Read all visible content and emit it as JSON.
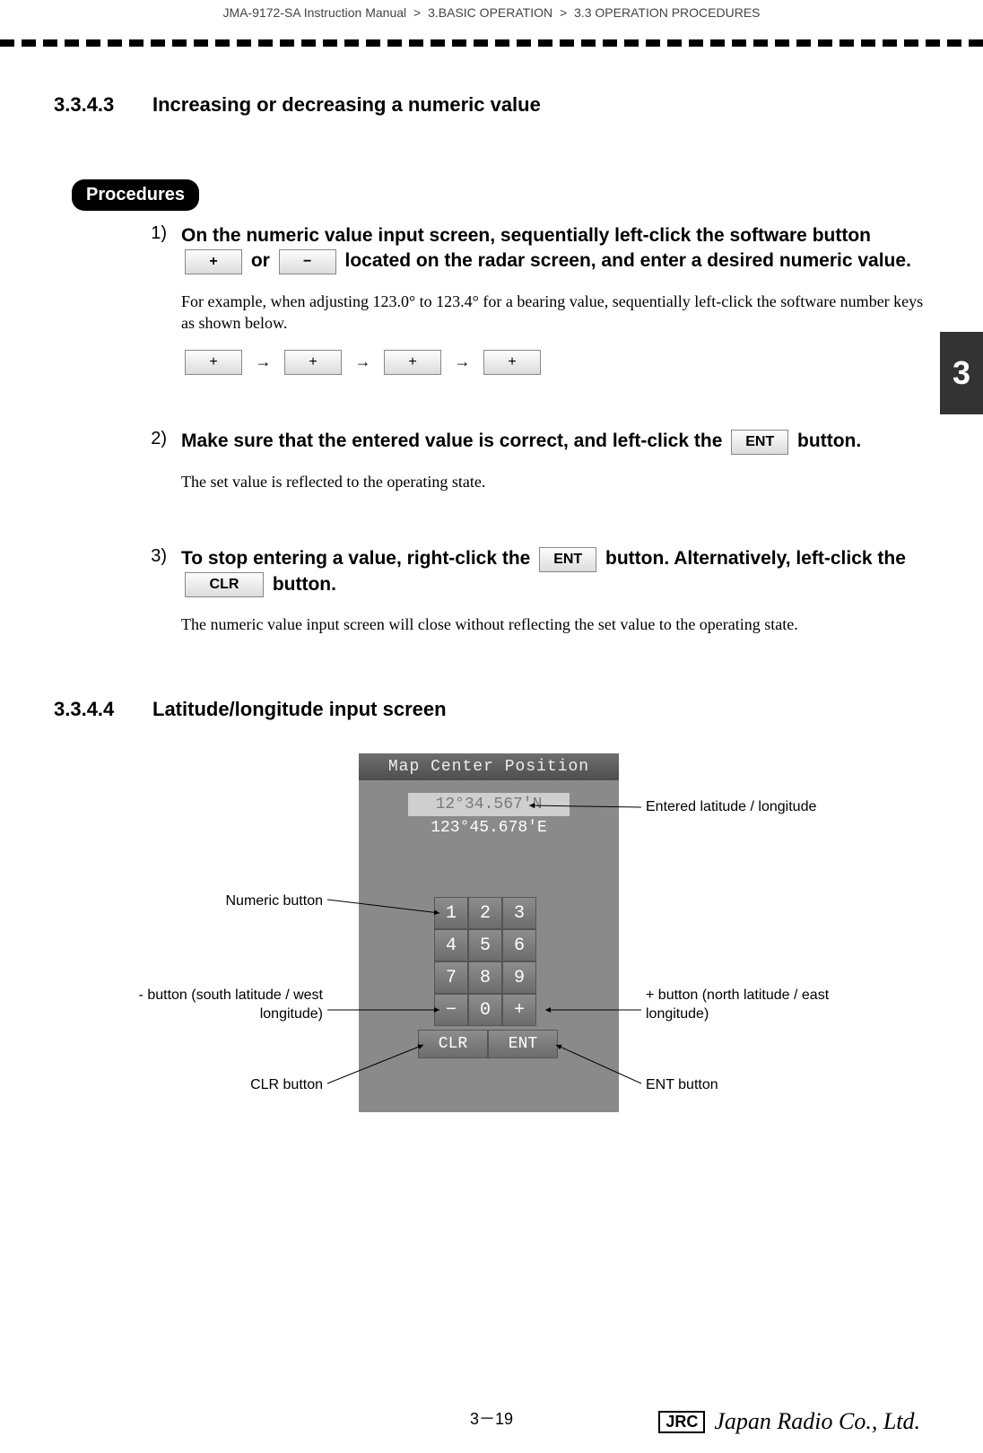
{
  "breadcrumb": {
    "a": "JMA-9172-SA Instruction Manual",
    "b": "3.BASIC OPERATION",
    "c": "3.3  OPERATION PROCEDURES",
    "sep": ">"
  },
  "chapter_tab": "3",
  "section_3343": {
    "num": "3.3.4.3",
    "title": "Increasing or decreasing a numeric value"
  },
  "procedures_label": "Procedures",
  "step1": {
    "num": "1)",
    "lead_a": "On the numeric value input screen, sequentially left-click the software button ",
    "btn_plus": "+",
    "lead_or": " or ",
    "btn_minus": "−",
    "lead_b": " located on the radar screen, and enter a desired numeric value.",
    "para": "For example, when adjusting 123.0° to 123.4° for a bearing value, sequentially left-click the software number keys as shown below.",
    "seq_btn": "+",
    "arrow": "→"
  },
  "step2": {
    "num": "2)",
    "lead_a": "Make sure that the entered value is correct, and left-click the ",
    "btn_ent": "ENT",
    "lead_b": " button.",
    "para": "The set value is reflected to the operating state."
  },
  "step3": {
    "num": "3)",
    "lead_a": "To stop entering a value, right-click the ",
    "btn_ent": "ENT",
    "lead_b": " button. Alternatively, left-click the ",
    "btn_clr": "CLR",
    "lead_c": " button.",
    "para": "The numeric value input screen will close without reflecting the set value to the operating state."
  },
  "section_3344": {
    "num": "3.3.4.4",
    "title": "Latitude/longitude input screen"
  },
  "lat_panel": {
    "title": "Map Center Position",
    "lat": "12°34.567'N",
    "lon": "123°45.678'E",
    "keys": [
      "1",
      "2",
      "3",
      "4",
      "5",
      "6",
      "7",
      "8",
      "9",
      "−",
      "0",
      "+"
    ],
    "clr": "CLR",
    "ent": "ENT"
  },
  "callouts": {
    "numeric": "Numeric button",
    "minus": "- button (south latitude / west longitude)",
    "clr": "CLR button",
    "entered": "Entered latitude / longitude",
    "plus": "+ button (north latitude / east longitude)",
    "ent": "ENT button"
  },
  "footer": {
    "page": "3－19",
    "jrc_box": "JRC",
    "jrc_script": "Japan Radio Co., Ltd."
  }
}
